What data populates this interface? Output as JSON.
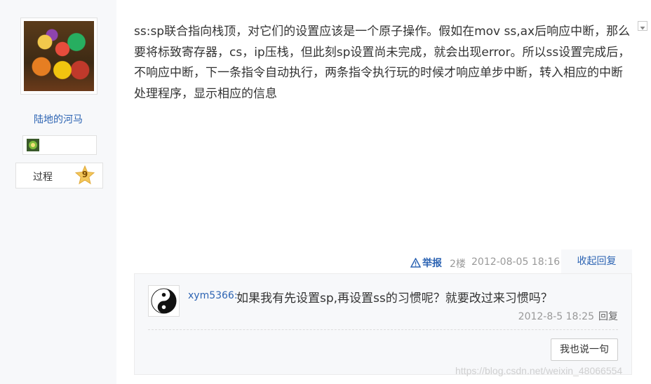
{
  "author": {
    "username": "陆地的河马",
    "level_name": "过程",
    "level_number": "9"
  },
  "post": {
    "content": "ss:sp联合指向栈顶，对它们的设置应该是一个原子操作。假如在mov ss,ax后响应中断，那么要将标致寄存器，cs，ip压栈，但此刻sp设置尚未完成，就会出现error。所以ss设置完成后，不响应中断，下一条指令自动执行，两条指令执行玩的时候才响应单步中断，转入相应的中断处理程序，显示相应的信息",
    "report_label": "举报",
    "floor": "2楼",
    "time": "2012-08-05 18:16",
    "collapse_label": "收起回复"
  },
  "reply": {
    "user": "xym5366:",
    "text": "如果我有先设置sp,再设置ss的习惯呢？就要改过来习惯吗？",
    "time": "2012-8-5 18:25",
    "reply_label": "回复",
    "say_button": "我也说一句"
  },
  "watermark": "https://blog.csdn.net/weixin_48066554",
  "colors": {
    "link": "#2d64b3",
    "sidebar_bg": "#f7f8fa",
    "meta": "#999999"
  }
}
